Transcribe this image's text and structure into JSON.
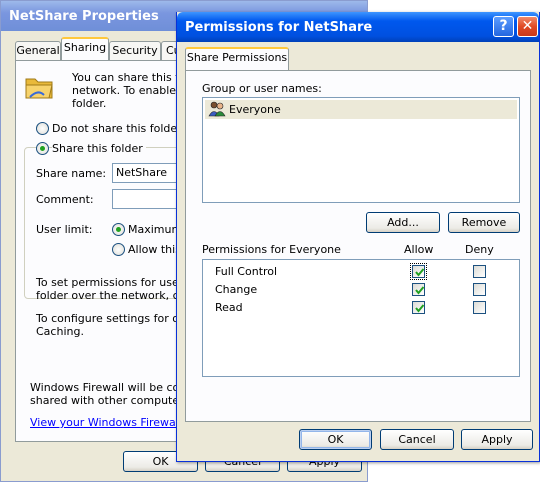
{
  "properties": {
    "title": "NetShare Properties",
    "tabs": [
      "General",
      "Sharing",
      "Security",
      "Cu"
    ],
    "intro_lines": [
      "You can share this fold",
      "network.  To enable sha",
      "folder."
    ],
    "radio_no_share": "Do not share this folder",
    "radio_share": "Share this folder",
    "share_name_label": "Share name:",
    "share_name_value": "NetShare",
    "comment_label": "Comment:",
    "user_limit_label": "User limit:",
    "user_limit_max": "Maximum a",
    "user_limit_allow": "Allow this n",
    "perm_text_lines": [
      "To set permissions for users w",
      "folder over the network, click"
    ],
    "offline_text_lines": [
      "To configure settings for offline",
      "Caching."
    ],
    "firewall_lines": [
      "Windows Firewall will be configu",
      "shared with other computers on"
    ],
    "firewall_link": "View your Windows Firewall set",
    "ok_label": "OK",
    "cancel_label": "Cancel",
    "apply_label": "Apply"
  },
  "permissions": {
    "title": "Permissions for NetShare",
    "help_glyph": "?",
    "close_glyph": "✕",
    "tab": "Share Permissions",
    "group_label": "Group or user names:",
    "users": [
      "Everyone"
    ],
    "add_label": "Add...",
    "remove_label": "Remove",
    "perm_header": "Permissions for Everyone",
    "allow_header": "Allow",
    "deny_header": "Deny",
    "rows": [
      {
        "name": "Full Control",
        "allow": true,
        "deny": false
      },
      {
        "name": "Change",
        "allow": true,
        "deny": false
      },
      {
        "name": "Read",
        "allow": true,
        "deny": false
      }
    ],
    "ok_label": "OK",
    "cancel_label": "Cancel",
    "apply_label": "Apply"
  },
  "colors": {
    "titlebar_active": "#0058ee",
    "titlebar_inactive": "#7a96df",
    "selection": "#ece9d8",
    "check_green": "#21a121",
    "close_red": "#e04a25"
  }
}
